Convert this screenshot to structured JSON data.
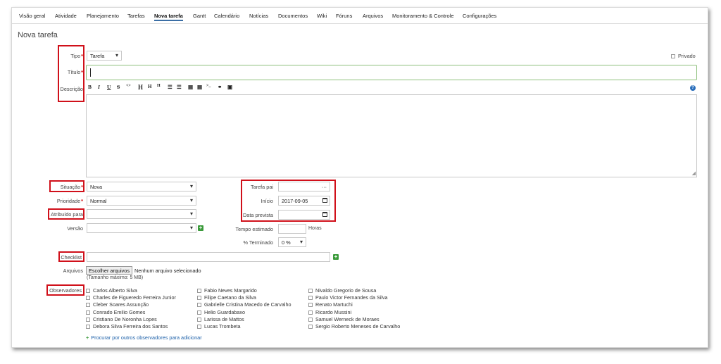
{
  "tabs": [
    {
      "label": "Visão geral"
    },
    {
      "label": "Atividade"
    },
    {
      "label": "Planejamento"
    },
    {
      "label": "Tarefas"
    },
    {
      "label": "Nova tarefa"
    },
    {
      "label": "Gantt"
    },
    {
      "label": "Calendário"
    },
    {
      "label": "Notícias"
    },
    {
      "label": "Documentos"
    },
    {
      "label": "Wiki"
    },
    {
      "label": "Fóruns"
    },
    {
      "label": "Arquivos"
    },
    {
      "label": "Monitoramento & Controle"
    },
    {
      "label": "Configurações"
    }
  ],
  "page_title": "Nova tarefa",
  "form": {
    "tipo": {
      "label": "Tipo",
      "value": "Tarefa"
    },
    "privado": {
      "label": "Privado"
    },
    "titulo": {
      "label": "Título",
      "value": ""
    },
    "descricao": {
      "label": "Descrição"
    },
    "toolbar": [
      "B",
      "I",
      "U",
      "S",
      "<>",
      "H",
      "H",
      "H",
      "☰",
      "☰",
      "▤",
      "▤",
      ">_",
      "⚭",
      "▣"
    ],
    "situacao": {
      "label": "Situação",
      "value": "Nova"
    },
    "prioridade": {
      "label": "Prioridade",
      "value": "Normal"
    },
    "atribuido": {
      "label": "Atribuído para",
      "value": ""
    },
    "versao": {
      "label": "Versão",
      "value": ""
    },
    "tarefa_pai": {
      "label": "Tarefa pai",
      "value": "···"
    },
    "inicio": {
      "label": "Início",
      "value": "2017-09-05"
    },
    "data_prevista": {
      "label": "Data prevista",
      "value": ""
    },
    "tempo_estimado": {
      "label": "Tempo estimado",
      "unit": "Horas"
    },
    "terminado": {
      "label": "% Terminado",
      "value": "0 %"
    },
    "checklist": {
      "label": "Checklist"
    },
    "arquivos": {
      "label": "Arquivos",
      "button": "Escolher arquivos",
      "status": "Nenhum arquivo selecionado",
      "hint": "(Tamanho máximo: 5 MB)"
    },
    "observadores": {
      "label": "Observadores",
      "col1": [
        "Carlos Alberto Silva",
        "Charles de Figueredo Ferreira Junior",
        "Cleber Soares Assunção",
        "Conrado Emilio Gomes",
        "Cristiano De Noronha Lopes",
        "Debora Silva Ferreira dos Santos"
      ],
      "col2": [
        "Fabio Neves Margarido",
        "Filipe Caetano da Silva",
        "Gabrielle Cristina Macedo de Carvalho",
        "Helio Guardabaxo",
        "Larissa de Mattos",
        "Lucas Trombeta"
      ],
      "col3": [
        "Nivaldo Gregorio de Sousa",
        "Paulo Victor Fernandes da Silva",
        "Renato Martuchi",
        "Ricardo Mussini",
        "Samuel Werneck de Moraes",
        "Sergio Roberto Meneses de Carvalho"
      ],
      "search_link": "Procurar por outros observadores para adicionar"
    }
  },
  "colors": {
    "highlight": "#d0101a",
    "link": "#1b5fa8",
    "plus": "#3a9a3a"
  }
}
